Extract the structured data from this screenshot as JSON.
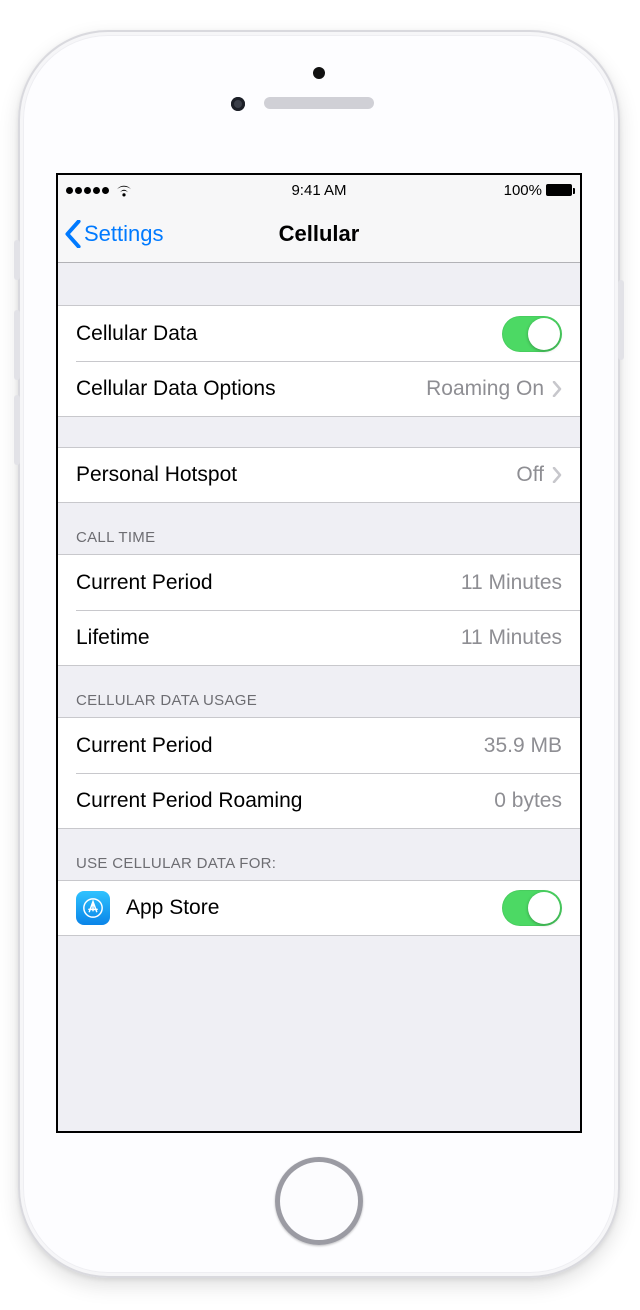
{
  "status_bar": {
    "time": "9:41 AM",
    "battery_pct": "100%"
  },
  "nav": {
    "back_label": "Settings",
    "title": "Cellular"
  },
  "rows": {
    "cellular_data": "Cellular Data",
    "cellular_data_options": {
      "label": "Cellular Data Options",
      "value": "Roaming On"
    },
    "personal_hotspot": {
      "label": "Personal Hotspot",
      "value": "Off"
    }
  },
  "sections": {
    "call_time": {
      "header": "CALL TIME",
      "current_period": {
        "label": "Current Period",
        "value": "11 Minutes"
      },
      "lifetime": {
        "label": "Lifetime",
        "value": "11 Minutes"
      }
    },
    "data_usage": {
      "header": "CELLULAR DATA USAGE",
      "current_period": {
        "label": "Current Period",
        "value": "35.9 MB"
      },
      "roaming": {
        "label": "Current Period Roaming",
        "value": "0 bytes"
      }
    },
    "use_for": {
      "header": "USE CELLULAR DATA FOR:",
      "app_store": "App Store"
    }
  }
}
